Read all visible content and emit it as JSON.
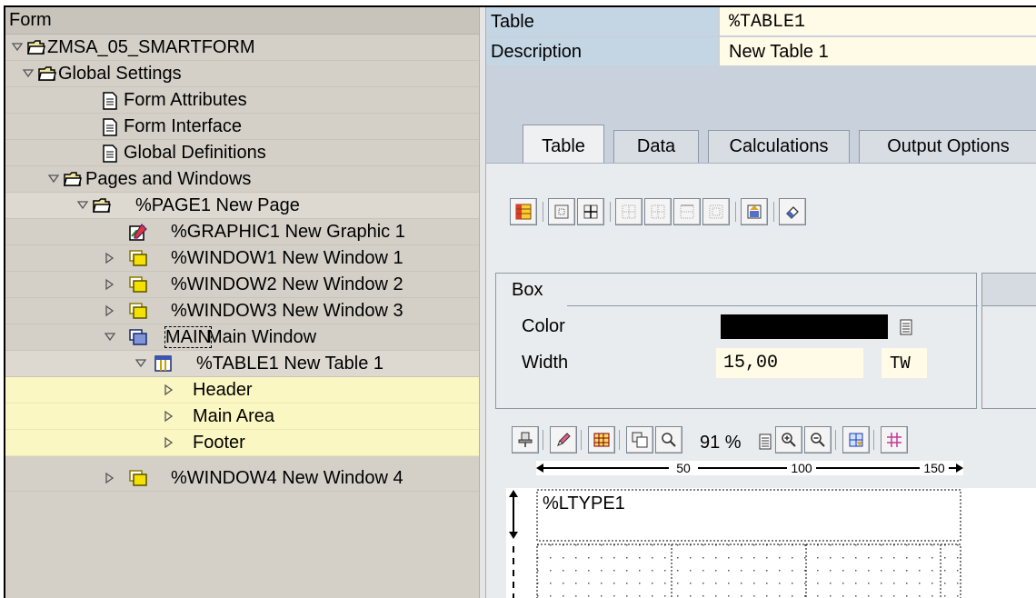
{
  "tree": {
    "header": "Form",
    "nodes": [
      {
        "label": "ZMSA_05_SMARTFORM",
        "icon": "folder-open-icon",
        "expander": "down"
      },
      {
        "label": "Global Settings",
        "icon": "folder-open-icon",
        "expander": "down"
      },
      {
        "label": "Form Attributes",
        "icon": "document-icon",
        "expander": ""
      },
      {
        "label": "Form Interface",
        "icon": "document-icon",
        "expander": ""
      },
      {
        "label": "Global Definitions",
        "icon": "document-icon",
        "expander": ""
      },
      {
        "label": "Pages and Windows",
        "icon": "folder-open-icon",
        "expander": "down"
      },
      {
        "label": "%PAGE1 New Page",
        "icon": "folder-open-icon",
        "expander": "down"
      },
      {
        "label": "%GRAPHIC1 New Graphic 1",
        "icon": "graphic-icon",
        "expander": ""
      },
      {
        "label": "%WINDOW1 New Window 1",
        "icon": "window-icon",
        "expander": "right"
      },
      {
        "label": "%WINDOW2 New Window 2",
        "icon": "window-icon",
        "expander": "right"
      },
      {
        "label": "%WINDOW3 New Window 3",
        "icon": "window-icon",
        "expander": "right"
      },
      {
        "label_main": "MAIN",
        "label_rest": " Main Window",
        "icon": "main-window-icon",
        "expander": "down"
      },
      {
        "label": "%TABLE1 New Table 1",
        "icon": "table-icon",
        "expander": "down"
      },
      {
        "label": "Header",
        "icon": "",
        "expander": "right"
      },
      {
        "label": "Main Area",
        "icon": "",
        "expander": "right"
      },
      {
        "label": "Footer",
        "icon": "",
        "expander": "right"
      },
      {
        "label": "%WINDOW4 New Window 4",
        "icon": "window-icon",
        "expander": "right"
      }
    ]
  },
  "header_fields": {
    "table_label": "Table",
    "table_value": "%TABLE1",
    "description_label": "Description",
    "description_value": "New Table 1"
  },
  "tabs": [
    "Table",
    "Data",
    "Calculations",
    "Output Options"
  ],
  "active_tab": "Table",
  "box_group": {
    "title": "Box",
    "color_label": "Color",
    "color_value": "#000000",
    "width_label": "Width",
    "width_value": "15,00",
    "width_unit": "TW"
  },
  "layout_toolbar": {
    "zoom": "91 %"
  },
  "ruler": {
    "ticks": [
      "50",
      "100",
      "150"
    ]
  },
  "canvas": {
    "line_type": "%LTYPE1"
  },
  "colors": {
    "tree_bg": "#d4d0c8",
    "tree_highlight": "#fbf7c2",
    "right_bg": "#c9d1dc",
    "input_bg": "#fffbe6"
  }
}
